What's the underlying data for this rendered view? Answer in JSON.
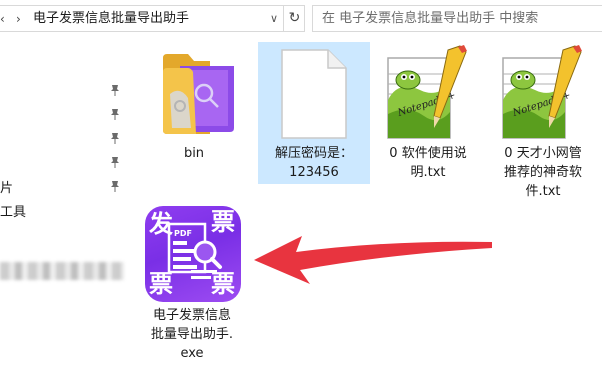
{
  "address_bar": {
    "path": "电子发票信息批量导出助手",
    "separator_glyph": "›",
    "dropdown_glyph": "∨",
    "refresh_glyph": "↻"
  },
  "search": {
    "placeholder": "在 电子发票信息批量导出助手 中搜索"
  },
  "nav_pane": {
    "items": [
      {
        "label": "片"
      },
      {
        "label": "工具"
      }
    ]
  },
  "files": [
    {
      "name": "bin",
      "type": "folder"
    },
    {
      "name_lines": [
        "解压密码是：",
        "123456"
      ],
      "type": "blank-file",
      "selected": true
    },
    {
      "name_lines": [
        "0 软件使用说",
        "明.txt"
      ],
      "type": "notepad-txt"
    },
    {
      "name_lines": [
        "0 天才小网管",
        "推荐的神奇软",
        "件.txt"
      ],
      "type": "notepad-txt"
    },
    {
      "name_lines": [
        "电子发票信息",
        "批量导出助手.",
        "exe"
      ],
      "type": "exe"
    }
  ],
  "exe_icon": {
    "chars": [
      "发",
      "票",
      "票",
      "票"
    ],
    "badge": "PDF"
  },
  "colors": {
    "selection": "#cce8ff",
    "arrow": "#e8343f",
    "exe_purple": "#8a3aed",
    "folder_yellow": "#f4c44a"
  }
}
